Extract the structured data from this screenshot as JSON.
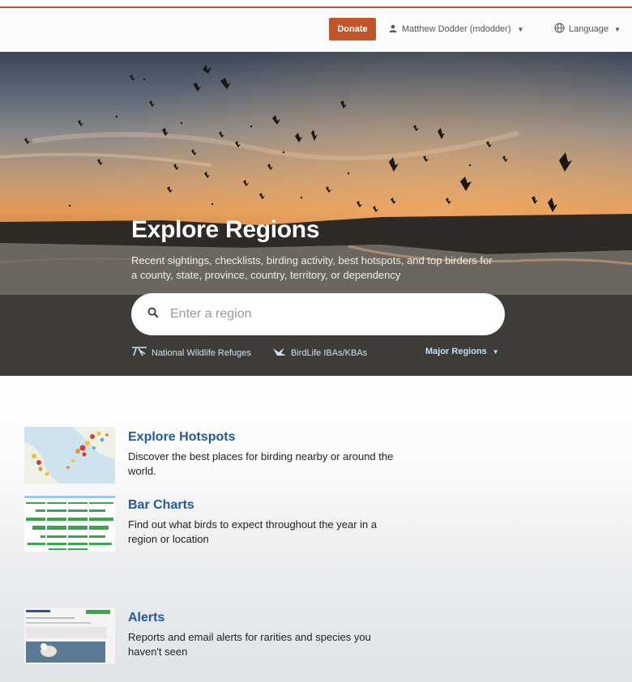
{
  "topbar": {
    "donate_label": "Donate",
    "user_label": "Matthew Dodder (mdodder)",
    "language_label": "Language",
    "accent_color": "#c4552a"
  },
  "hero": {
    "title": "Explore Regions",
    "subtitle": "Recent sightings, checklists, birding activity, best hotspots, and top birders for a county, state, province, country, territory, or dependency",
    "search_placeholder": "Enter a region",
    "links": {
      "refuges": "National Wildlife Refuges",
      "iba": "BirdLife IBAs/KBAs",
      "major": "Major Regions"
    }
  },
  "features": [
    {
      "title": "Explore Hotspots",
      "desc": "Discover the best places for birding nearby or around the world.",
      "icon": "hotspot-map-thumbnail"
    },
    {
      "title": "Bar Charts",
      "desc": "Find out what birds to expect throughout the year in a region or location",
      "icon": "bar-chart-thumbnail"
    },
    {
      "title": "Alerts",
      "desc": "Reports and email alerts for rarities and species you haven't seen",
      "icon": "alerts-thumbnail"
    }
  ],
  "colors": {
    "link_blue": "#1f5a9c",
    "hotspot_red": "#d93a2b",
    "hotspot_yellow": "#f1c232",
    "bar_green": "#3aa64a"
  }
}
